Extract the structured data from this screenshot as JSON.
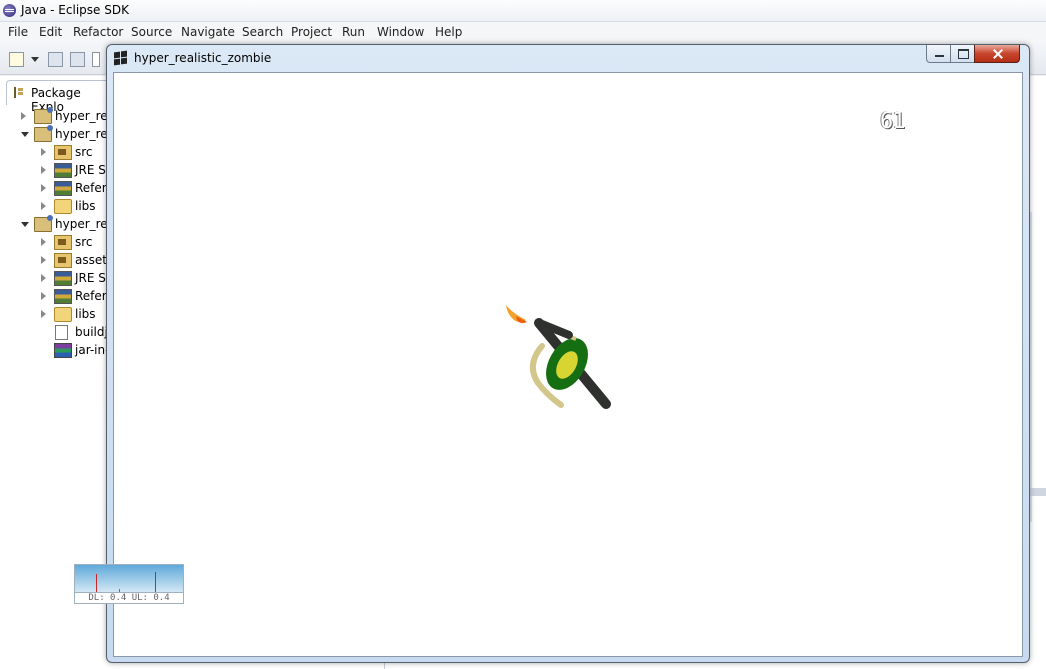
{
  "window": {
    "title": "Java - Eclipse SDK"
  },
  "menu": [
    "File",
    "Edit",
    "Refactor",
    "Source",
    "Navigate",
    "Search",
    "Project",
    "Run",
    "Window",
    "Help"
  ],
  "package_explorer": {
    "tab_label": "Package Explo",
    "tree": [
      {
        "label": "hyper_rea",
        "icon": "project-icon",
        "state": "closed",
        "indent": 0
      },
      {
        "label": "hyper_rea",
        "icon": "project-icon",
        "state": "open",
        "indent": 0
      },
      {
        "label": "src",
        "icon": "source-folder-icon",
        "state": "closed",
        "indent": 1
      },
      {
        "label": "JRE Sy",
        "icon": "library-icon",
        "state": "closed",
        "indent": 1
      },
      {
        "label": "Refere",
        "icon": "library-icon",
        "state": "closed",
        "indent": 1
      },
      {
        "label": "libs",
        "icon": "folder-icon",
        "state": "closed",
        "indent": 1
      },
      {
        "label": "hyper_rea",
        "icon": "project-icon",
        "state": "open",
        "indent": 0
      },
      {
        "label": "src",
        "icon": "source-folder-icon",
        "state": "closed",
        "indent": 1
      },
      {
        "label": "assets",
        "icon": "source-folder-icon",
        "state": "closed",
        "indent": 1
      },
      {
        "label": "JRE Sy",
        "icon": "library-icon",
        "state": "closed",
        "indent": 1
      },
      {
        "label": "Refere",
        "icon": "library-icon",
        "state": "closed",
        "indent": 1
      },
      {
        "label": "libs",
        "icon": "folder-icon",
        "state": "closed",
        "indent": 1
      },
      {
        "label": "buildj",
        "icon": "file-icon",
        "state": "none",
        "indent": 1
      },
      {
        "label": "jar-in-",
        "icon": "jar-icon",
        "state": "none",
        "indent": 1
      }
    ]
  },
  "app_window": {
    "title": "hyper_realistic_zombie",
    "fps": "61"
  },
  "net_graph": {
    "label": "DL: 0.4 UL: 0.4"
  },
  "colors": {
    "zombie_body": "#166e12",
    "zombie_head": "#d8d432",
    "zombie_arm": "#d2c68a",
    "torch": "#2e312e",
    "flame": "#f07a12"
  }
}
